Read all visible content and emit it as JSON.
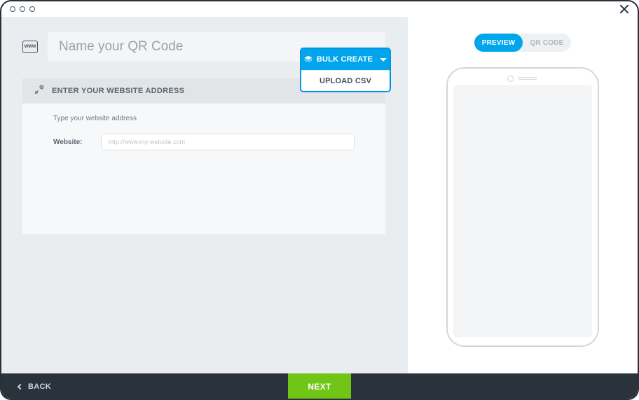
{
  "name_field": {
    "placeholder": "Name your QR Code",
    "value": ""
  },
  "bulk_dropdown": {
    "button_label": "BULK CREATE",
    "option_label": "UPLOAD CSV"
  },
  "section": {
    "title": "ENTER YOUR WEBSITE ADDRESS",
    "hint": "Type your website address",
    "field_label": "Website:",
    "field_placeholder": "http://www.my-website.com",
    "field_value": ""
  },
  "preview_toggle": {
    "active": "PREVIEW",
    "inactive": "QR CODE"
  },
  "footer": {
    "back": "BACK",
    "next": "NEXT"
  }
}
